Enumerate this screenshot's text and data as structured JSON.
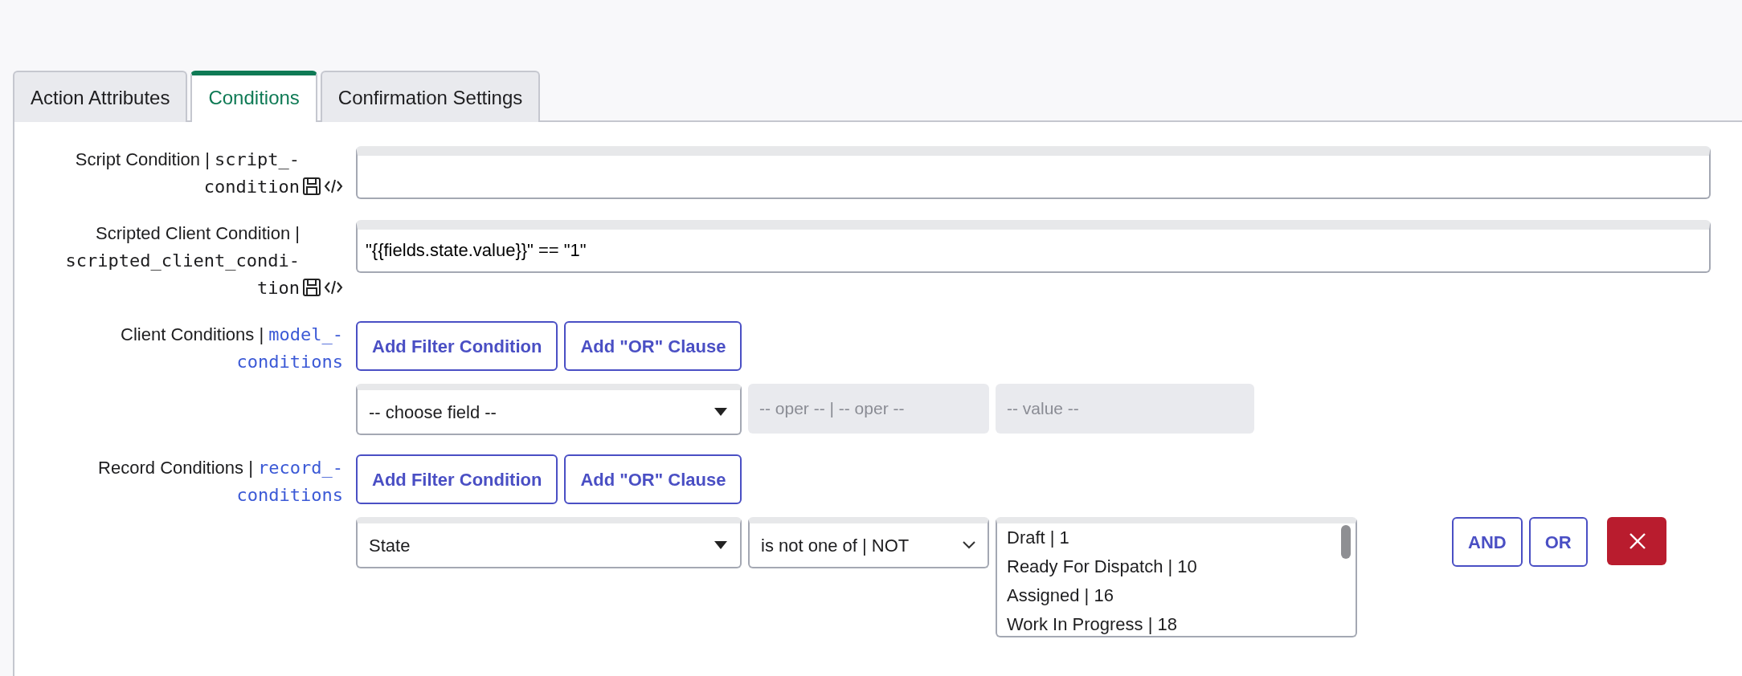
{
  "tabs": [
    {
      "label": "Action Attributes",
      "selected": false
    },
    {
      "label": "Conditions",
      "selected": true
    },
    {
      "label": "Confirmation Settings",
      "selected": false
    }
  ],
  "fields": [
    {
      "kind": "text",
      "label": "Script Condition |",
      "field_name_lines": [
        "script_-",
        "condition"
      ],
      "linked": false,
      "icons": true
    },
    {
      "kind": "text",
      "label": "Scripted Client Condition |",
      "field_name_lines": [
        "scripted_client_condi-",
        "tion"
      ],
      "linked": false,
      "icons": true,
      "value": "\"{{fields.state.value}}\" == \"1\""
    },
    {
      "kind": "filter",
      "label": "Client Conditions |",
      "field_name_lines": [
        "model_-",
        "conditions"
      ],
      "linked": true,
      "icons": false,
      "buttons": [
        "Add Filter Condition",
        "Add \"OR\" Clause"
      ],
      "condition": {
        "field": "-- choose field --",
        "operator": "-- oper -- | -- oper --",
        "value_placeholder": "-- value --"
      }
    },
    {
      "kind": "filter",
      "label": "Record Conditions |",
      "field_name_lines": [
        "record_-",
        "conditions"
      ],
      "linked": true,
      "icons": false,
      "buttons": [
        "Add Filter Condition",
        "Add \"OR\" Clause"
      ],
      "condition": {
        "field": "State",
        "operator": "is not one of | NOT",
        "values": [
          "Draft | 1",
          "Ready For Dispatch | 10",
          "Assigned | 16",
          "Work In Progress | 18"
        ],
        "actions": [
          "AND",
          "OR"
        ]
      }
    }
  ]
}
